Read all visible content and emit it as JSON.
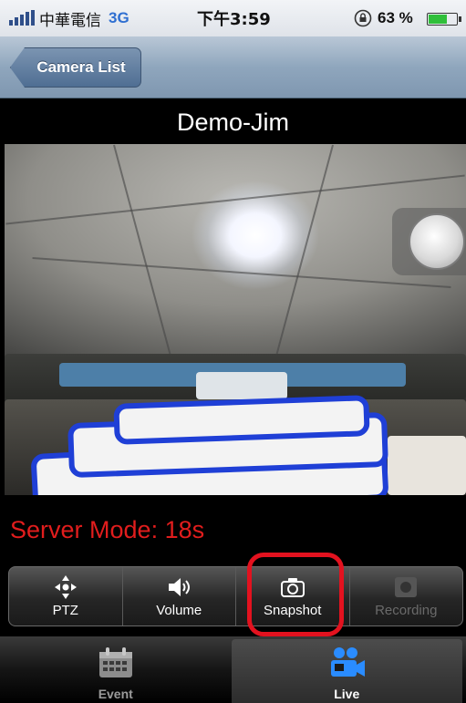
{
  "status_bar": {
    "carrier": "中華電信",
    "network": "3G",
    "time": "下午3:59",
    "battery_percent": "63 %",
    "battery_level": 0.63,
    "icons": [
      "signal-icon",
      "rotation-lock-icon",
      "battery-icon"
    ]
  },
  "nav_bar": {
    "back_label": "Camera List"
  },
  "camera": {
    "name": "Demo-Jim"
  },
  "server_mode": "Server Mode: 18s",
  "controls": [
    {
      "label": "PTZ",
      "icon": "ptz-arrows-icon",
      "enabled": true
    },
    {
      "label": "Volume",
      "icon": "speaker-icon",
      "enabled": true
    },
    {
      "label": "Snapshot",
      "icon": "camera-icon",
      "enabled": true
    },
    {
      "label": "Recording",
      "icon": "record-icon",
      "enabled": false
    }
  ],
  "tabs": [
    {
      "label": "Event",
      "icon": "calendar-icon",
      "active": false
    },
    {
      "label": "Live",
      "icon": "video-users-icon",
      "active": true
    }
  ],
  "colors": {
    "server_mode_text": "#e11d1d",
    "highlight_ring": "#e3121f",
    "nav_bar": "#8fa6bd",
    "live_icon": "#2a8cff"
  }
}
